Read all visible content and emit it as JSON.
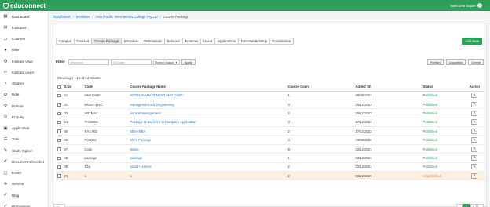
{
  "app": {
    "logo_text": "educonnect",
    "welcome": "Welcome Super"
  },
  "sidebar": {
    "items": [
      {
        "label": "Dashboard",
        "icon": "dashboard-icon"
      },
      {
        "label": "Institutes",
        "icon": "institutes-icon"
      },
      {
        "label": "Courses",
        "icon": "courses-icon"
      },
      {
        "label": "User",
        "icon": "user-icon"
      },
      {
        "label": "Institute User",
        "icon": "institute-user-icon"
      },
      {
        "label": "Institute Links",
        "icon": "link-icon"
      },
      {
        "label": "Student",
        "icon": "student-icon"
      },
      {
        "label": "Role",
        "icon": "role-icon"
      },
      {
        "label": "Partner",
        "icon": "partner-icon"
      },
      {
        "label": "Enquiry",
        "icon": "enquiry-icon"
      },
      {
        "label": "Application",
        "icon": "application-icon"
      },
      {
        "label": "Task",
        "icon": "task-icon"
      },
      {
        "label": "Study Option",
        "icon": "study-option-icon"
      },
      {
        "label": "Document Checklist",
        "icon": "checklist-icon"
      },
      {
        "label": "Event",
        "icon": "event-icon"
      },
      {
        "label": "Service",
        "icon": "service-icon"
      },
      {
        "label": "Blog",
        "icon": "blog-icon"
      },
      {
        "label": "Promotions",
        "icon": "promotions-icon"
      }
    ]
  },
  "breadcrumb": {
    "home": "Dashboard",
    "institutes": "Institutes",
    "college": "Asia Pacific International College Pty Ltd",
    "current": "Course Package",
    "sep": "/"
  },
  "tabs": [
    "Campus",
    "Courses",
    "Course Package",
    "Enquiries",
    "Testimonials",
    "Services",
    "Features",
    "Users",
    "Applications",
    "Documents Setup",
    "Commission"
  ],
  "add_button": "Add New",
  "filter": {
    "label": "Filter",
    "keyword_placeholder": "Keyword",
    "date_placeholder": "On Date",
    "status_select": "Select Status",
    "apply": "Apply",
    "publish": "Publish",
    "unpublish": "Unpublish",
    "delete": "Delete"
  },
  "showing": "Showing 1 - 10 of 14 results",
  "table": {
    "headers": [
      "S.No",
      "Code",
      "Course Package Name",
      "Course Count",
      "Added On",
      "Status",
      "Action"
    ],
    "rows": [
      {
        "sno": "01",
        "code": "HM+CHEF",
        "name": "HOTEL MANAGEMENT AND CHEF",
        "count": "1",
        "added": "09/05/2024",
        "status": "Published"
      },
      {
        "sno": "02",
        "code": "MGMT-ENG",
        "name": "management and Engineering",
        "count": "3",
        "added": "29/12/2023",
        "status": "Published"
      },
      {
        "sno": "03",
        "code": "ARTMA1",
        "name": "Art and Management",
        "count": "2",
        "added": "29/12/2023",
        "status": "Published"
      },
      {
        "sno": "04",
        "code": "PKGBCA",
        "name": "Package of Bachelor in Computer Application",
        "count": "3",
        "added": "27/12/2023",
        "status": "Published"
      },
      {
        "sno": "05",
        "code": "RAS 001",
        "name": "MBA+BBA",
        "count": "2",
        "added": "17/10/2023",
        "status": "Published"
      },
      {
        "sno": "06",
        "code": "PCK001",
        "name": "Merit Package",
        "count": "3",
        "added": "09/09/2022",
        "status": "Published"
      },
      {
        "sno": "07",
        "code": "Code",
        "name": "Name",
        "count": "9",
        "added": "02/12/2021",
        "status": "Published"
      },
      {
        "sno": "08",
        "code": "package",
        "name": "package",
        "count": "1",
        "added": "02/12/2021",
        "status": "Published"
      },
      {
        "sno": "09",
        "code": "S3a",
        "name": "social+science",
        "count": "2",
        "added": "02/12/2021",
        "status": "Published"
      },
      {
        "sno": "10",
        "code": "a",
        "name": "a",
        "count": "2",
        "added": "02/12/2021",
        "status": "Unpublished"
      }
    ]
  },
  "pagination": {
    "page_size": "10",
    "prev": "‹",
    "pages": [
      "1",
      "2"
    ],
    "next": "›",
    "current_page": "1"
  },
  "colors": {
    "brand": "#2e9e5b",
    "link": "#2a75c9",
    "unpublished": "#e08a2c",
    "highlight_row": "#fdeee2"
  }
}
